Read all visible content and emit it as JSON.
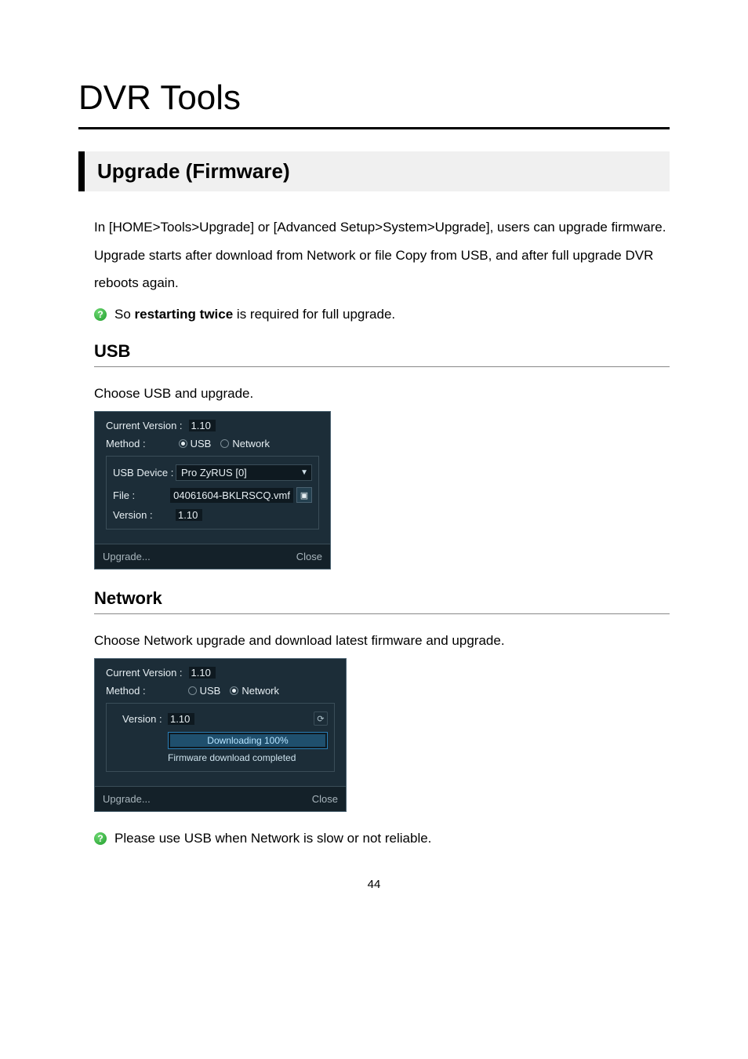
{
  "page_number": "44",
  "title": "DVR Tools",
  "section": {
    "heading": "Upgrade (Firmware)",
    "intro": "In [HOME>Tools>Upgrade] or [Advanced Setup>System>Upgrade], users can upgrade firmware. Upgrade starts after download from Network or file Copy from USB, and after full upgrade DVR reboots again.",
    "note_prefix": "So ",
    "note_bold": "restarting twice",
    "note_suffix": " is required for full upgrade."
  },
  "usb": {
    "heading": "USB",
    "desc": "Choose USB and upgrade.",
    "panel": {
      "curver_label": "Current Version :",
      "curver_value": "1.10",
      "method_label": "Method :",
      "opt_usb": "USB",
      "opt_net": "Network",
      "device_label": "USB Device :",
      "device_value": "Pro ZyRUS [0]",
      "file_label": "File :",
      "file_value": "04061604-BKLRSCQ.vmf",
      "version_label": "Version :",
      "version_value": "1.10",
      "btn_upgrade": "Upgrade...",
      "btn_close": "Close"
    }
  },
  "network": {
    "heading": "Network",
    "desc": "Choose Network upgrade and download latest firmware and upgrade.",
    "panel": {
      "curver_label": "Current Version :",
      "curver_value": "1.10",
      "method_label": "Method :",
      "opt_usb": "USB",
      "opt_net": "Network",
      "version_label": "Version :",
      "version_value": "1.10",
      "dl_text": "Downloading 100%",
      "dl_msg": "Firmware download completed",
      "btn_upgrade": "Upgrade...",
      "btn_close": "Close"
    },
    "note": "Please use USB when Network is slow or not reliable."
  }
}
